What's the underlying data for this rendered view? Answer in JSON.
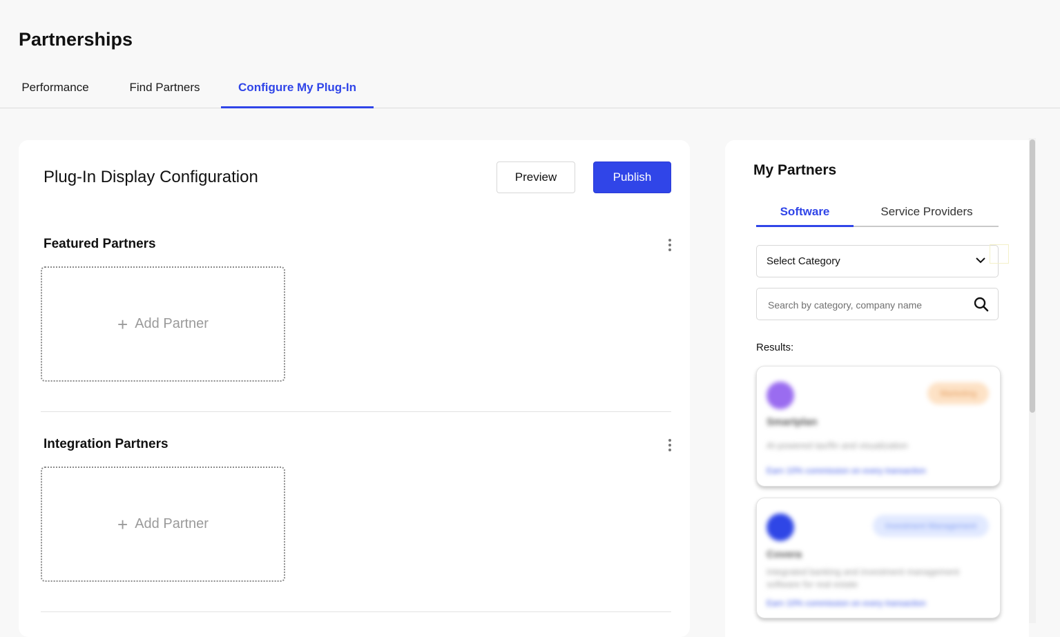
{
  "page": {
    "title": "Partnerships"
  },
  "tabs": [
    {
      "label": "Performance"
    },
    {
      "label": "Find Partners"
    },
    {
      "label": "Configure My Plug-In"
    }
  ],
  "config": {
    "title": "Plug-In Display Configuration",
    "preview_label": "Preview",
    "publish_label": "Publish",
    "sections": [
      {
        "title": "Featured Partners",
        "add_label": "Add Partner"
      },
      {
        "title": "Integration Partners",
        "add_label": "Add Partner"
      }
    ]
  },
  "sidebar": {
    "title": "My Partners",
    "tabs": [
      {
        "label": "Software"
      },
      {
        "label": "Service Providers"
      }
    ],
    "category_select": {
      "value": "Select Category"
    },
    "search": {
      "placeholder": "Search by category, company name"
    },
    "results_label": "Results:",
    "results": [
      {
        "name": "Smartplan",
        "badge": "Marketing",
        "description": "AI-powered tax/fin and visualization",
        "link": "Earn 10% commission on every transaction",
        "logo_color": "#9a6cf0",
        "badge_bg": "#fde2c6",
        "badge_color": "#e39a5a"
      },
      {
        "name": "Covera",
        "badge": "Investment Management",
        "description": "Integrated banking and investment management software for real estate",
        "link": "Earn 10% commission on every transaction",
        "logo_color": "#2f46e6",
        "badge_bg": "#e1e9ff",
        "badge_color": "#7f9af0"
      }
    ]
  },
  "colors": {
    "accent": "#3045e8"
  }
}
